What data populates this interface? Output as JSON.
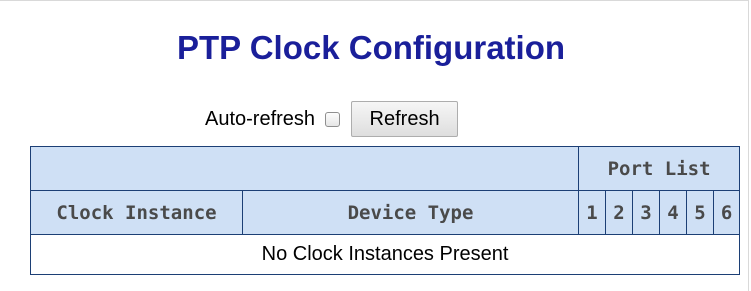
{
  "page": {
    "title": "PTP Clock Configuration"
  },
  "controls": {
    "auto_refresh_label": "Auto-refresh",
    "auto_refresh_checked": false,
    "refresh_label": "Refresh"
  },
  "table": {
    "group_header": "Port List",
    "columns": {
      "clock_instance": "Clock Instance",
      "device_type": "Device Type",
      "ports": [
        "1",
        "2",
        "3",
        "4",
        "5",
        "6"
      ]
    },
    "empty_message": "No Clock Instances Present"
  }
}
